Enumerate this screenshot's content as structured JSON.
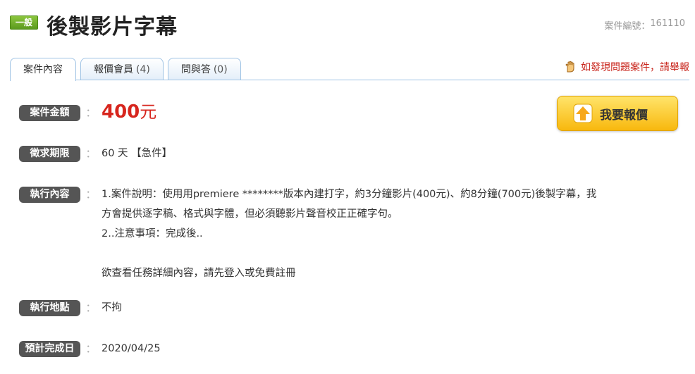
{
  "header": {
    "badge": "一般",
    "title": "後製影片字幕",
    "case_number_label": "案件編號：",
    "case_number": "161110"
  },
  "tabs": [
    {
      "label": "案件內容",
      "count": ""
    },
    {
      "label": "報價會員",
      "count": "(4)"
    },
    {
      "label": "問與答",
      "count": "(0)"
    }
  ],
  "report_link": "如發現問題案件，請舉報",
  "details": {
    "amount": {
      "label": "案件金額",
      "value": "400",
      "unit": "元"
    },
    "deadline": {
      "label": "徵求期限",
      "value": "60 天 【急件】"
    },
    "content": {
      "label": "執行內容",
      "lines": [
        "1.案件說明：使用用premiere ********版本內建打字，約3分鐘影片(400元)、約8分鐘(700元)後製字幕，我",
        "方會提供逐字稿、格式與字體，但必須聽影片聲音校正正確字句。",
        "2..注意事項：完成後..",
        "",
        "欲查看任務詳細內容，請先登入或免費註冊"
      ]
    },
    "location": {
      "label": "執行地點",
      "value": "不拘"
    },
    "completion": {
      "label": "預計完成日",
      "value": "2020/04/25"
    }
  },
  "colon": "：",
  "quote_button": {
    "label": "我要報價",
    "icon": "arrow-up-icon"
  },
  "icons": {
    "report": "hand-icon"
  },
  "colors": {
    "price": "#d7261e",
    "badge": "#6aaa24",
    "button": "#f8b80e",
    "report": "#c8241b"
  }
}
